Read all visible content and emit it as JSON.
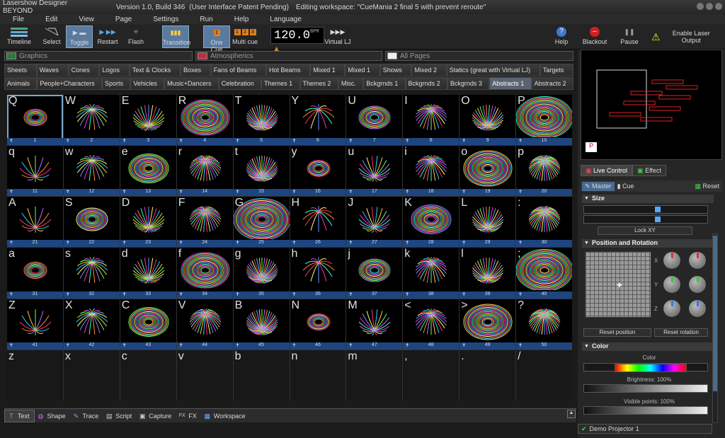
{
  "title": {
    "app": "Lasershow Designer BEYOND",
    "version": "Version 1.0, Build 346",
    "patent": "(User Interface Patent Pending)",
    "workspace": "Editing workspace: \"CueMania 2 final 5 with prevent reroute\""
  },
  "menu": [
    "File",
    "Edit",
    "View",
    "Page",
    "Settings",
    "Run",
    "Help",
    "Language"
  ],
  "toolbar": {
    "timeline": "Timeline",
    "select": "Select",
    "toggle": "Toggle",
    "restart": "Restart",
    "flash": "Flash",
    "transition": "Transition",
    "one_cue": "One Cue",
    "multi_cue": "Multi cue",
    "bpm": "120.0",
    "bpm_unit": "BPM",
    "virtual_lj": "Virtual LJ",
    "help": "Help",
    "blackout": "Blackout",
    "pause": "Pause",
    "enable_laser": "Enable Laser Output"
  },
  "filters": {
    "graphics": "Graphics",
    "atmospherics": "Atmospherics",
    "all_pages": "All Pages"
  },
  "categories_row1": [
    "Sheets",
    "Waves",
    "Cones",
    "Logos",
    "Text & Clocks",
    "Boxes",
    "Fans of Beams",
    "Hot Beams",
    "Mixed 1",
    "Mixed 1",
    "Shows",
    "Mixed 2",
    "Statics (great with Virtual LJ)",
    "Targets"
  ],
  "categories_row2": [
    "Animals",
    "People+Characters",
    "Sports",
    "Vehicles",
    "Music+Dancers",
    "Celebration",
    "Themes 1",
    "Themes 2",
    "Misc.",
    "Bckgrnds 1",
    "Bckgrnds 2",
    "Bckgrnds 3",
    "Abstracts 1",
    "Abstracts 2"
  ],
  "selected_category": "Abstracts 1",
  "cues": [
    [
      "Q",
      "1"
    ],
    [
      "W",
      "2"
    ],
    [
      "E",
      "3"
    ],
    [
      "R",
      "4"
    ],
    [
      "T",
      "5"
    ],
    [
      "Y",
      "6"
    ],
    [
      "U",
      "7"
    ],
    [
      "I",
      "8"
    ],
    [
      "O",
      "9"
    ],
    [
      "P",
      "10"
    ],
    [
      "q",
      "11"
    ],
    [
      "w",
      "12"
    ],
    [
      "e",
      "13"
    ],
    [
      "r",
      "14"
    ],
    [
      "t",
      "15"
    ],
    [
      "y",
      "16"
    ],
    [
      "u",
      "17"
    ],
    [
      "i",
      "18"
    ],
    [
      "o",
      "19"
    ],
    [
      "p",
      "20"
    ],
    [
      "A",
      "21"
    ],
    [
      "S",
      "22"
    ],
    [
      "D",
      "23"
    ],
    [
      "F",
      "24"
    ],
    [
      "G",
      "25"
    ],
    [
      "H",
      "26"
    ],
    [
      "J",
      "27"
    ],
    [
      "K",
      "28"
    ],
    [
      "L",
      "29"
    ],
    [
      ":",
      "30"
    ],
    [
      "a",
      "31"
    ],
    [
      "s",
      "32"
    ],
    [
      "d",
      "33"
    ],
    [
      "f",
      "34"
    ],
    [
      "g",
      "35"
    ],
    [
      "h",
      "36"
    ],
    [
      "j",
      "37"
    ],
    [
      "k",
      "38"
    ],
    [
      "l",
      "39"
    ],
    [
      ";",
      "40"
    ],
    [
      "Z",
      "41"
    ],
    [
      "X",
      "42"
    ],
    [
      "C",
      "43"
    ],
    [
      "V",
      "44"
    ],
    [
      "B",
      "45"
    ],
    [
      "N",
      "46"
    ],
    [
      "M",
      "47"
    ],
    [
      "<",
      "48"
    ],
    [
      ">",
      "49"
    ],
    [
      "?",
      "50"
    ],
    [
      "z",
      ""
    ],
    [
      "x",
      ""
    ],
    [
      "c",
      ""
    ],
    [
      "v",
      ""
    ],
    [
      "b",
      ""
    ],
    [
      "n",
      ""
    ],
    [
      "m",
      ""
    ],
    [
      ",",
      ""
    ],
    [
      ".",
      ""
    ],
    [
      "/",
      ""
    ]
  ],
  "bottom_tabs": [
    "Text",
    "Shape",
    "Trace",
    "Script",
    "Capture",
    "FX",
    "Workspace"
  ],
  "right": {
    "live_control": "Live Control",
    "effect": "Effect",
    "master": "Master",
    "cue": "Cue",
    "reset": "Reset",
    "size": "Size",
    "lock_xy": "Lock XY",
    "pos_rot": "Position and Rotation",
    "x": "X",
    "y": "Y",
    "z": "Z",
    "reset_position": "Reset position",
    "reset_rotation": "Reset rotation",
    "color": "Color",
    "color_label": "Color",
    "brightness": "Brightness: 100%",
    "visible_points": "Visible points: 100%",
    "projector": "Demo Projector 1"
  }
}
